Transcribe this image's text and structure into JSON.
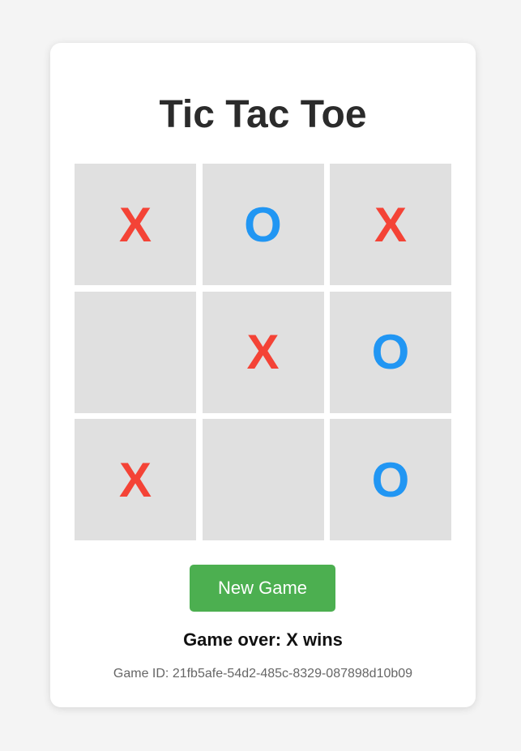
{
  "title": "Tic Tac Toe",
  "board": {
    "cells": [
      {
        "mark": "X"
      },
      {
        "mark": "O"
      },
      {
        "mark": "X"
      },
      {
        "mark": ""
      },
      {
        "mark": "X"
      },
      {
        "mark": "O"
      },
      {
        "mark": "X"
      },
      {
        "mark": ""
      },
      {
        "mark": "O"
      }
    ]
  },
  "colors": {
    "x": "#f44336",
    "o": "#2196f3",
    "cell_bg": "#e0e0e0",
    "button": "#4caf50"
  },
  "new_game_label": "New Game",
  "status": "Game over: X wins",
  "game_id": "Game ID: 21fb5afe-54d2-485c-8329-087898d10b09"
}
